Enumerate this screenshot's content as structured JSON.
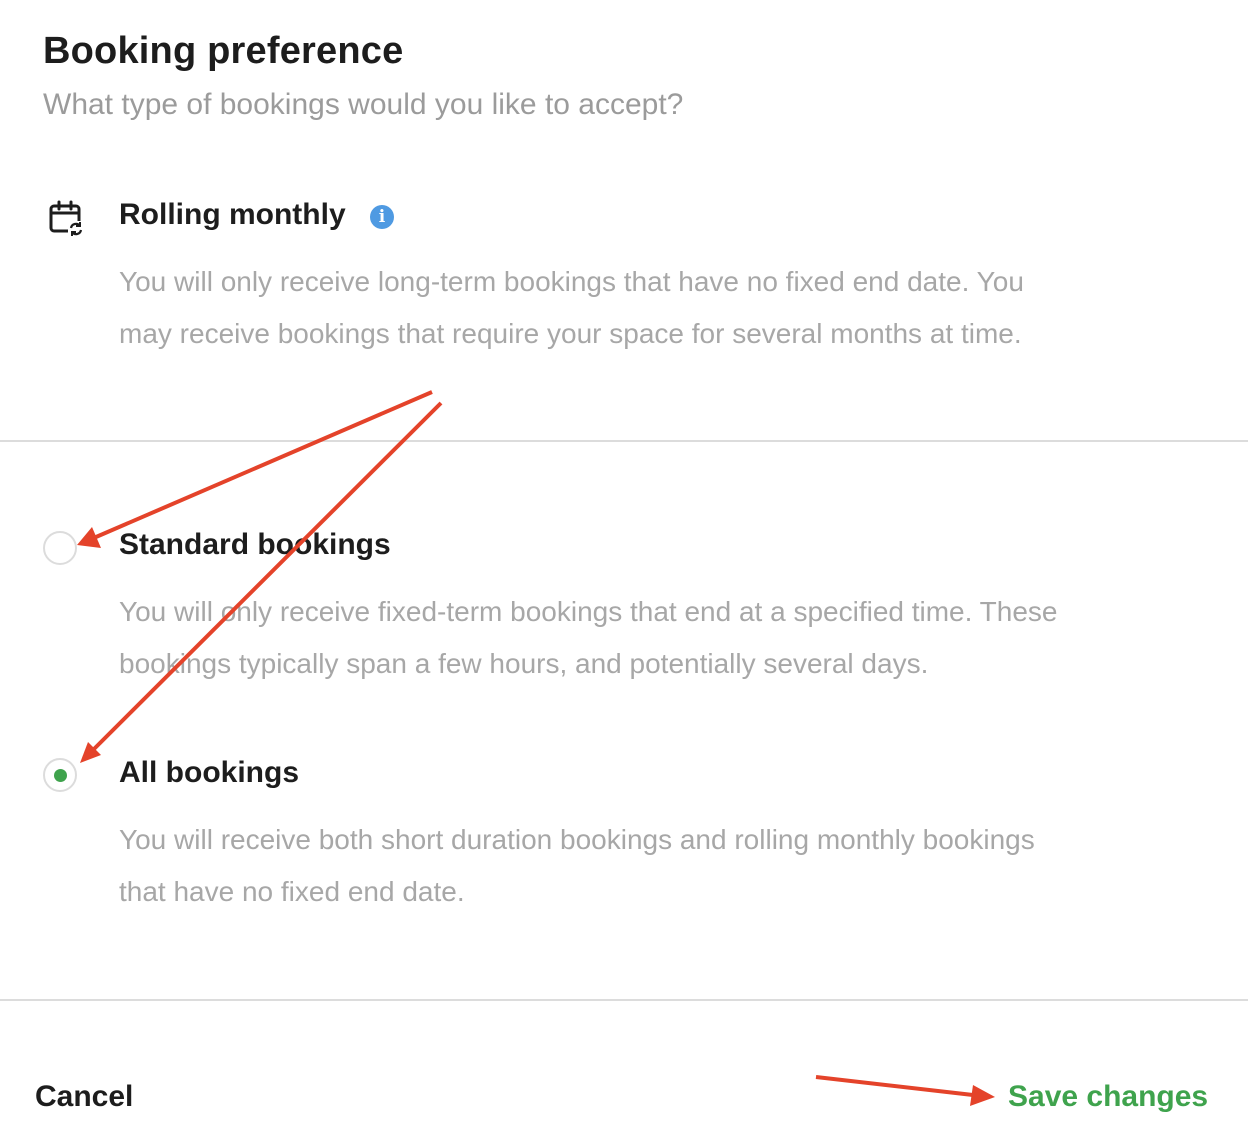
{
  "header": {
    "title": "Booking preference",
    "subtitle": "What type of bookings would you like to accept?"
  },
  "rolling": {
    "icon": "calendar-repeat-icon",
    "title": "Rolling monthly",
    "info_icon": "info-icon",
    "info_glyph": "i",
    "desc_line1": "You will only receive long-term bookings that have no fixed end date. You",
    "desc_line2": "may receive bookings that require your space for several months at time."
  },
  "options": [
    {
      "title": "Standard bookings",
      "selected": false,
      "desc_line1": "You will only receive fixed-term bookings that end at a specified time. These",
      "desc_line2": "bookings typically span a few hours, and potentially several days."
    },
    {
      "title": "All bookings",
      "selected": true,
      "desc_line1": "You will receive both short duration bookings and rolling monthly bookings",
      "desc_line2": "that have no fixed end date."
    }
  ],
  "footer": {
    "cancel_label": "Cancel",
    "save_label": "Save changes"
  },
  "colors": {
    "accent_green": "#3fa34d",
    "info_blue": "#4f9ae2",
    "annotation_red": "#e4432a"
  }
}
